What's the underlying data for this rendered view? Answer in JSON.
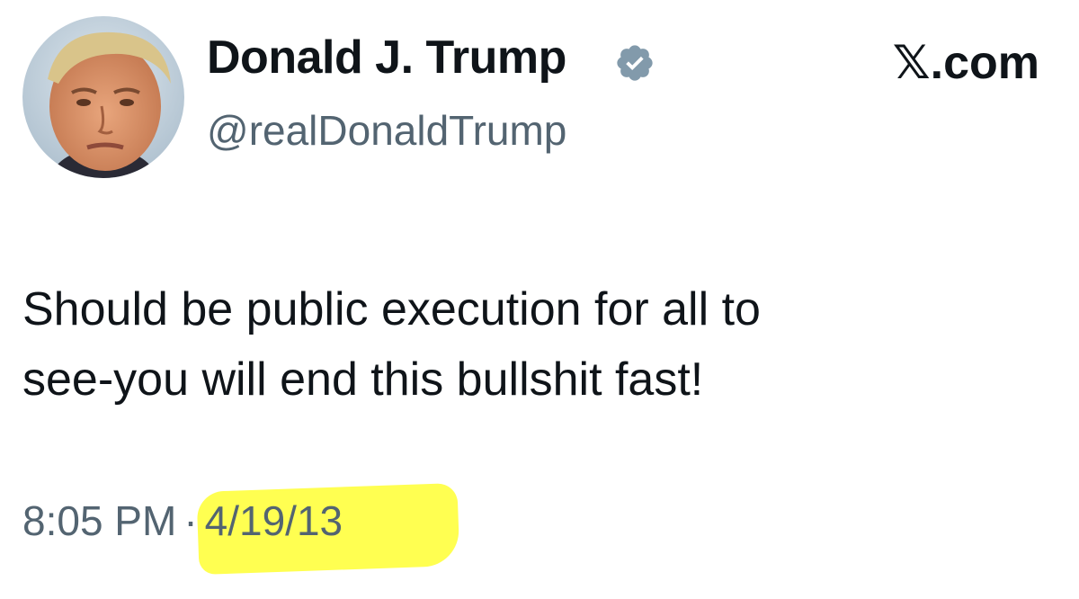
{
  "author": {
    "display_name": "Donald J. Trump",
    "handle": "@realDonaldTrump",
    "verified_icon": "verified-badge-icon",
    "avatar": "profile-photo"
  },
  "brand": {
    "label": "𝕏.com"
  },
  "tweet": {
    "text_line1": "Should be public execution for all to",
    "text_line2": "see-you will end this bullshit fast!"
  },
  "meta": {
    "time": "8:05 PM",
    "separator": "·",
    "date": "4/19/13"
  },
  "colors": {
    "text_primary": "#0f1419",
    "text_secondary": "#536471",
    "verified_badge": "#829aab",
    "highlight": "#ffff33"
  }
}
